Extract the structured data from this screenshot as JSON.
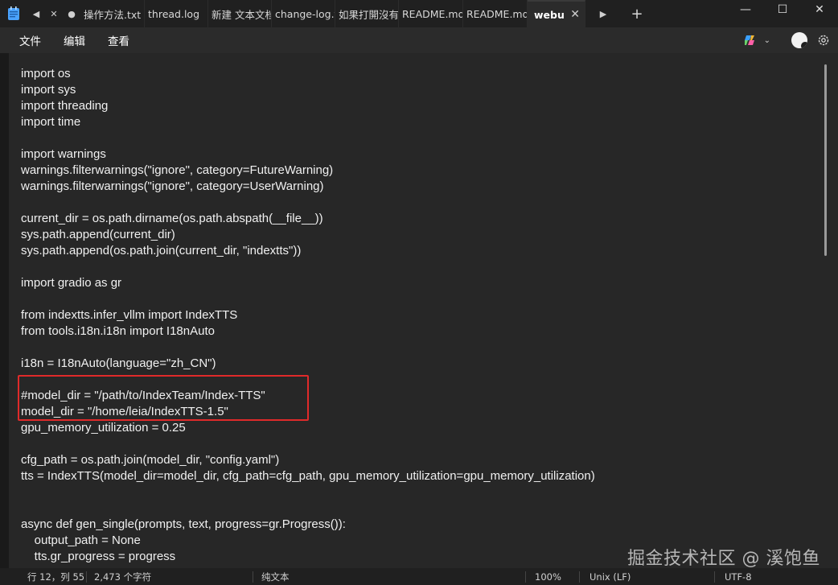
{
  "tabs": [
    {
      "label": "操作方法.txt"
    },
    {
      "label": "thread.log"
    },
    {
      "label": "新建 文本文档"
    },
    {
      "label": "change-log.t"
    },
    {
      "label": "如果打開沒有"
    },
    {
      "label": "README.md"
    },
    {
      "label": "README.md"
    },
    {
      "label": "webu",
      "active": true
    }
  ],
  "menu": {
    "file": "文件",
    "edit": "编辑",
    "view": "查看"
  },
  "code_lines": [
    "import os",
    "import sys",
    "import threading",
    "import time",
    "",
    "import warnings",
    "warnings.filterwarnings(\"ignore\", category=FutureWarning)",
    "warnings.filterwarnings(\"ignore\", category=UserWarning)",
    "",
    "current_dir = os.path.dirname(os.path.abspath(__file__))",
    "sys.path.append(current_dir)",
    "sys.path.append(os.path.join(current_dir, \"indextts\"))",
    "",
    "import gradio as gr",
    "",
    "from indextts.infer_vllm import IndexTTS",
    "from tools.i18n.i18n import I18nAuto",
    "",
    "i18n = I18nAuto(language=\"zh_CN\")",
    "",
    "#model_dir = \"/path/to/IndexTeam/Index-TTS\"",
    "model_dir = \"/home/leia/IndexTTS-1.5\"",
    "gpu_memory_utilization = 0.25",
    "",
    "cfg_path = os.path.join(model_dir, \"config.yaml\")",
    "tts = IndexTTS(model_dir=model_dir, cfg_path=cfg_path, gpu_memory_utilization=gpu_memory_utilization)",
    "",
    "",
    "async def gen_single(prompts, text, progress=gr.Progress()):",
    "    output_path = None",
    "    tts.gr_progress = progress"
  ],
  "watermark": "掘金技术社区 @ 溪饱鱼",
  "status": {
    "position": "行 12，列 55",
    "chars": "2,473 个字符",
    "format": "纯文本",
    "zoom": "100%",
    "line_ending": "Unix (LF)",
    "encoding": "UTF-8"
  },
  "colors": {
    "highlight": "#e02a2a",
    "editor_bg": "#272727",
    "title_bg": "#202020"
  }
}
